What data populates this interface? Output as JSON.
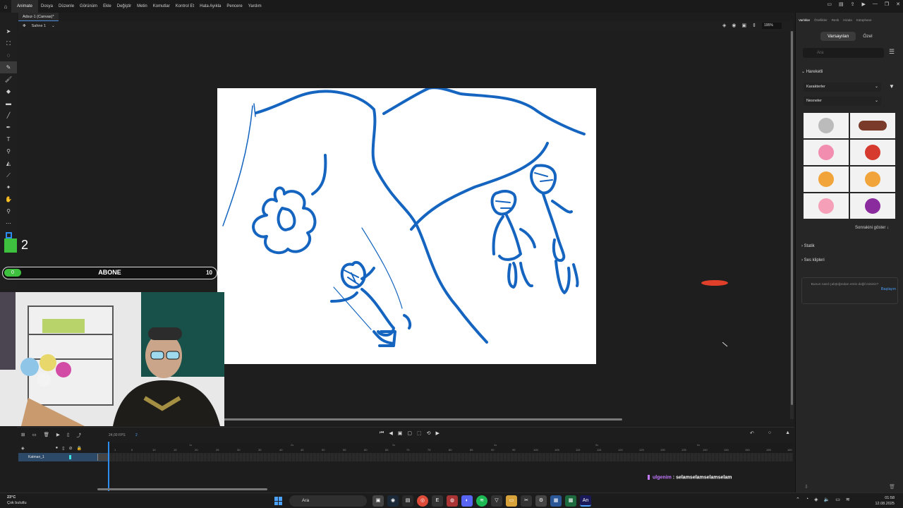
{
  "menubar": {
    "app_name": "Animate",
    "items": [
      "Dosya",
      "Düzenle",
      "Görünüm",
      "Ekle",
      "Değiştir",
      "Metin",
      "Komutlar",
      "Kontrol Et",
      "Hata Ayıkla",
      "Pencere",
      "Yardım"
    ]
  },
  "document": {
    "tab_title": "Adsız-1 (Canvas)*",
    "scene": "Sahne 1",
    "zoom": "195%"
  },
  "overlay": {
    "count": "2",
    "sub_current": "0",
    "sub_label": "ABONE",
    "sub_goal": "10",
    "sub_progress": 0
  },
  "right_panel": {
    "tabs": [
      "Varlıklar",
      "Özellikler",
      "Renk",
      "Hizala",
      "Kütüphane"
    ],
    "active_tab": "Varlıklar",
    "segments": [
      "Varsayılan",
      "Özel"
    ],
    "active_segment": "Varsayılan",
    "search_placeholder": "Ara",
    "section_animated": "Hareketli",
    "dropdown_1": "Karakterler",
    "dropdown_2": "Nesneler",
    "show_more": "Sonrakini göster ↓",
    "section_static": "Statik",
    "section_sound": "Ses klipleri",
    "hint_text": "Bunun nasıl çalıştığından emin değil misiniz?",
    "hint_link": "Başlayın"
  },
  "timeline": {
    "fps": "24,00",
    "fps_unit": "FPS",
    "current_frame": "2",
    "layer_name": "Katman_1",
    "frame_ticks": [
      1,
      5,
      10,
      15,
      20,
      25,
      30,
      35,
      40,
      45,
      50,
      55,
      60,
      65,
      70,
      75,
      80,
      85,
      90,
      95,
      100,
      105,
      110,
      115,
      120,
      125,
      130,
      135,
      140,
      145,
      150,
      155,
      160
    ],
    "second_marks": [
      "1s",
      "2s",
      "3s",
      "4s",
      "5s",
      "6s"
    ]
  },
  "chat": {
    "user": "ulgenim",
    "message": "selamselamselamselam"
  },
  "taskbar": {
    "temperature": "23°C",
    "weather": "Çok bulutlu",
    "search_label": "Ara",
    "time": "01:58",
    "date": "12.08.2025"
  },
  "colors": {
    "accent": "#2d8cf0",
    "sketch_stroke": "#1565c0",
    "sub_green": "#3ec13e",
    "chat_user": "#c479ff"
  }
}
